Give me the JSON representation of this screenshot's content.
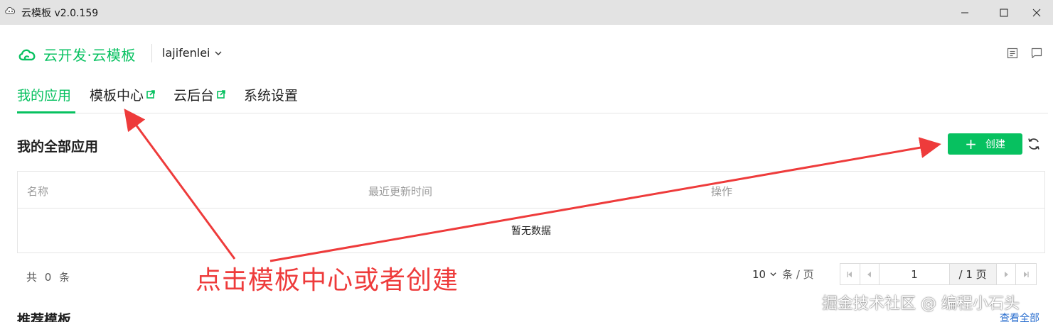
{
  "window": {
    "title": "云模板 v2.0.159"
  },
  "header": {
    "brand": "云开发·云模板",
    "account": "lajifenlei"
  },
  "tabs": [
    {
      "label": "我的应用",
      "active": true
    },
    {
      "label": "模板中心",
      "external": true
    },
    {
      "label": "云后台",
      "external": true
    },
    {
      "label": "系统设置"
    }
  ],
  "section": {
    "title": "我的全部应用",
    "create_label": "创建"
  },
  "table": {
    "columns": [
      "名称",
      "最近更新时间",
      "操作"
    ],
    "empty_text": "暂无数据"
  },
  "footer": {
    "total": "共 0 条",
    "page_size": "10",
    "page_size_unit": "条 / 页",
    "current_page": "1",
    "total_pages": "/ 1 页"
  },
  "annotation": {
    "text": "点击模板中心或者创建"
  },
  "recommend": {
    "title": "推荐模板",
    "view_all": "查看全部"
  },
  "watermark": "掘金技术社区 @ 编程小石头",
  "colors": {
    "brand_green": "#07c160",
    "annotation_red": "#ee3b3b",
    "link_blue": "#2b6fcf"
  },
  "icons": [
    "app-icon",
    "cloud-logo-icon",
    "chevron-down-icon",
    "document-icon",
    "message-icon",
    "external-link-icon",
    "plus-icon",
    "refresh-icon",
    "first-page-icon",
    "prev-page-icon",
    "next-page-icon",
    "last-page-icon"
  ]
}
